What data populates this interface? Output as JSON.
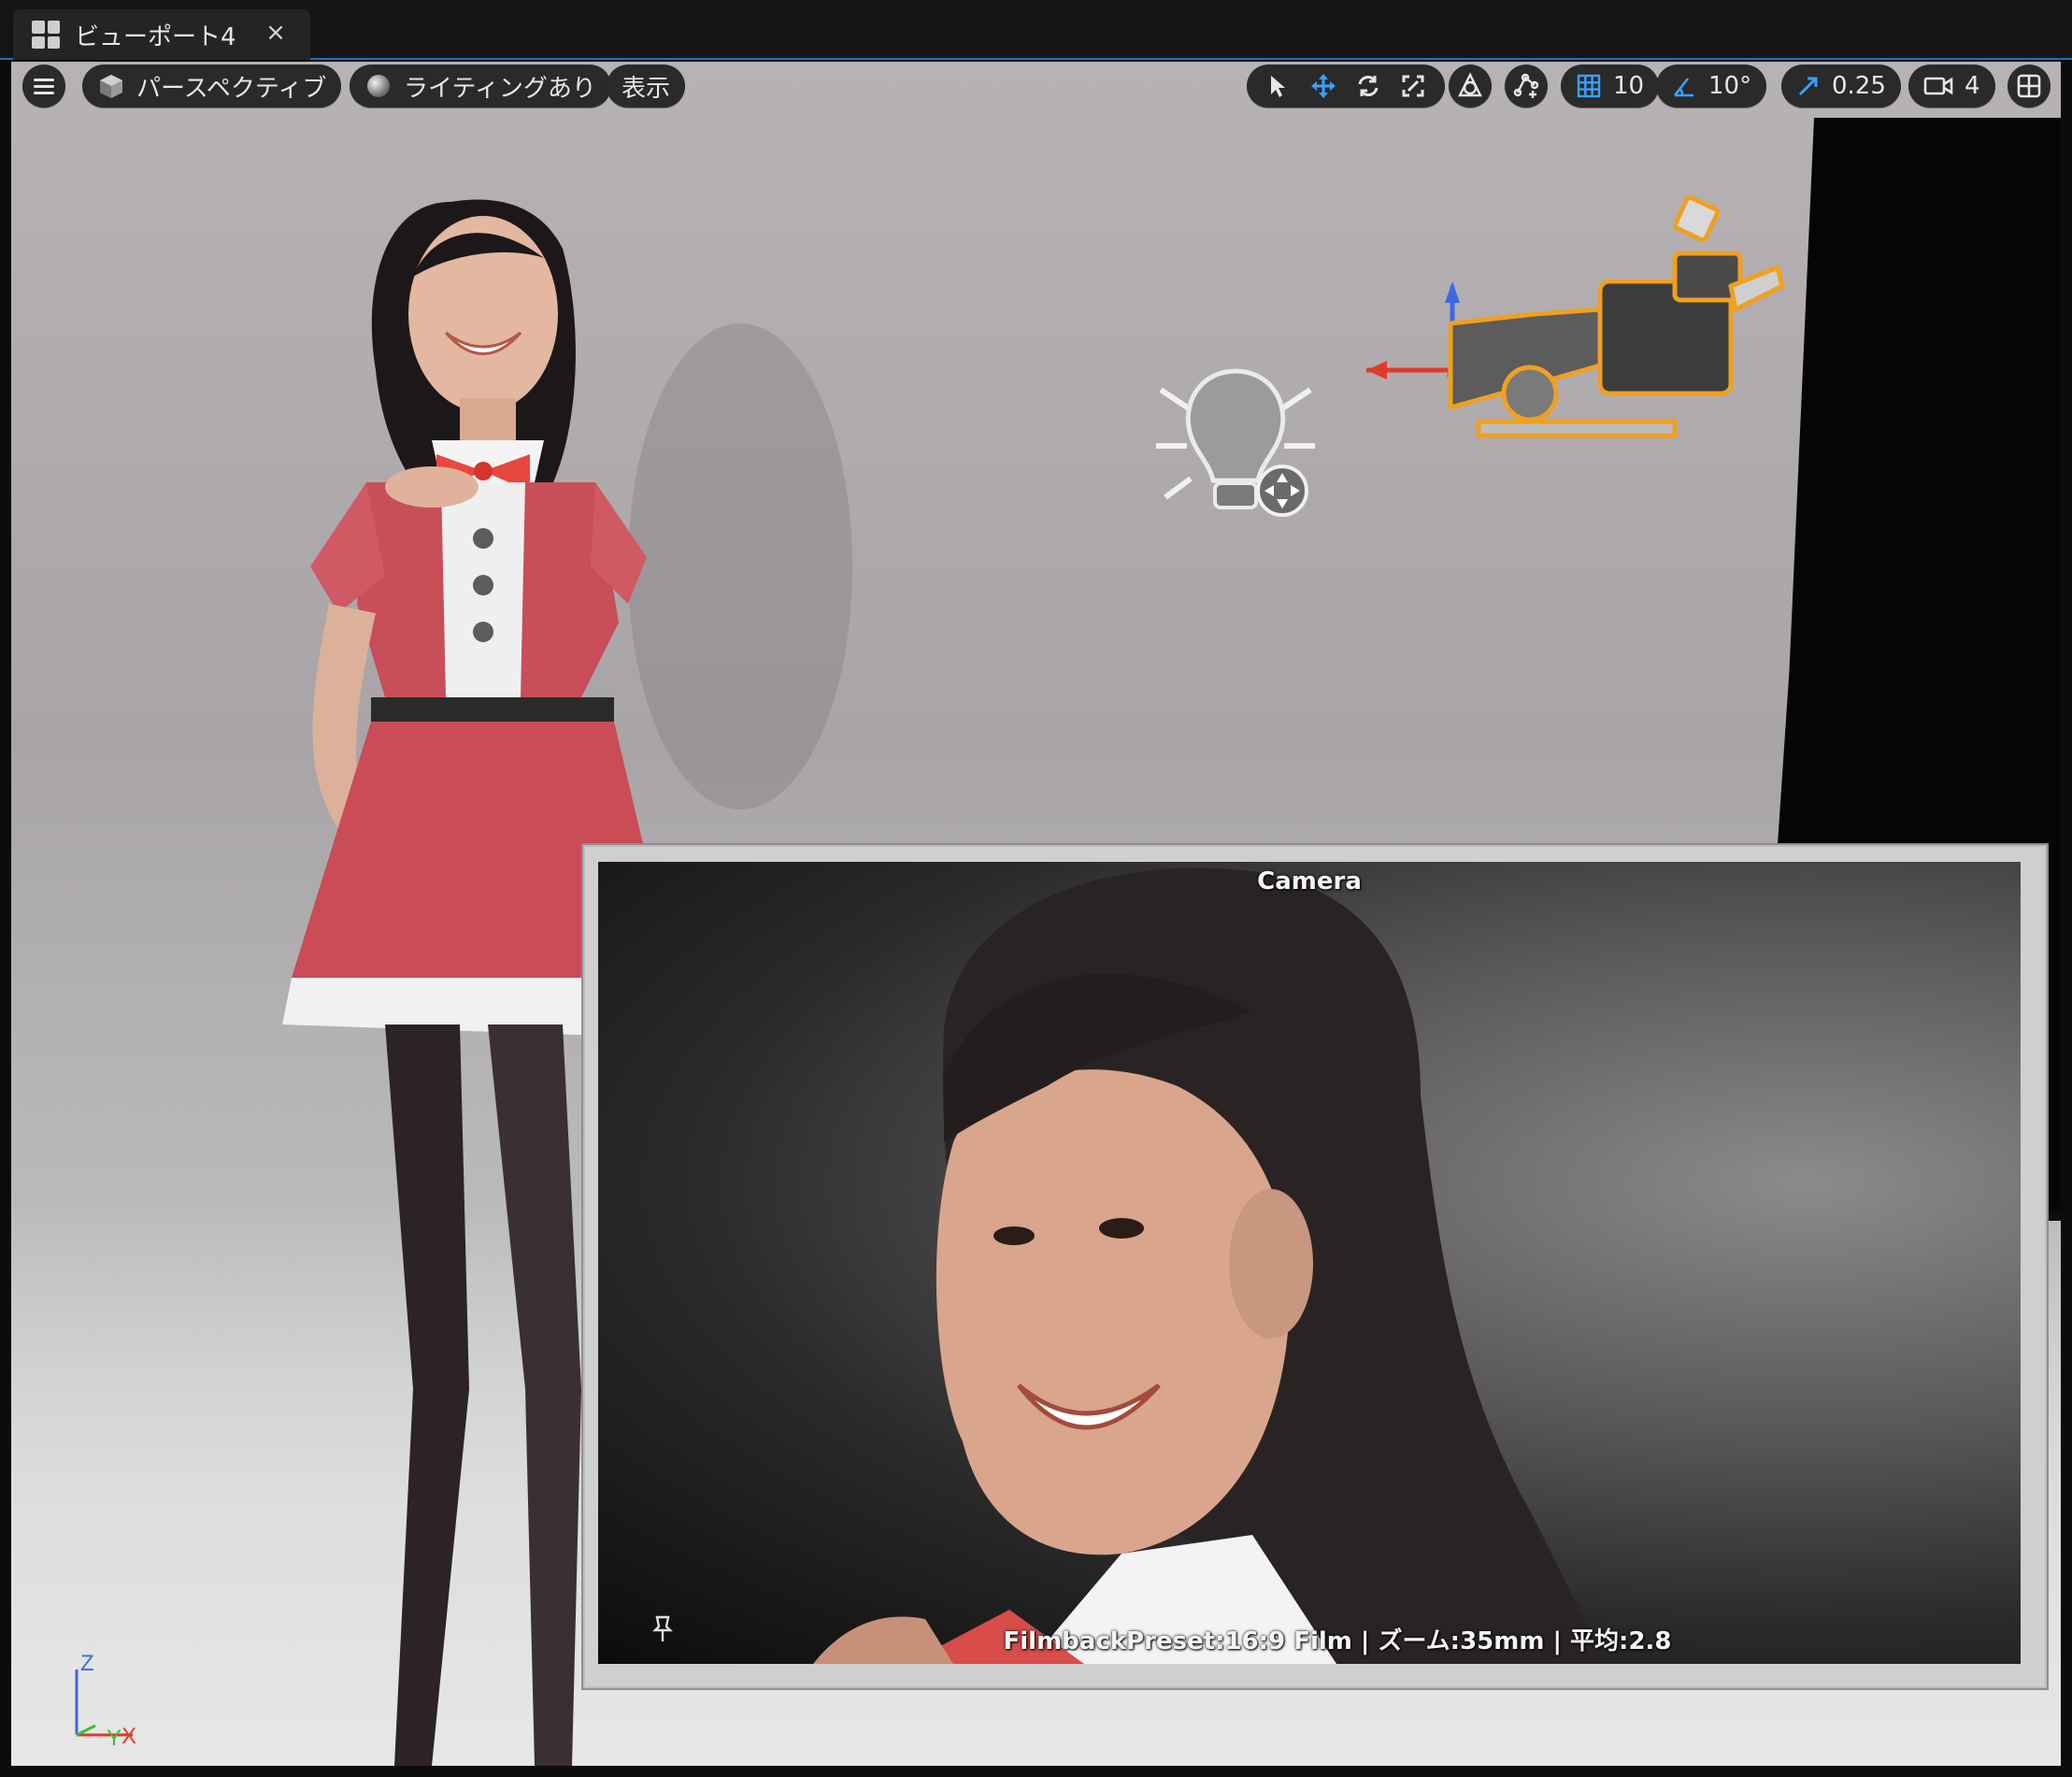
{
  "tab": {
    "title": "ビューポート4",
    "close_glyph": "×",
    "icon": "viewport-layout-icon"
  },
  "toolbar": {
    "perspective_label": "パースペクティブ",
    "lighting_label": "ライティングあり",
    "show_label": "表示",
    "grid_snap_value": "10",
    "rotation_snap_value": "10°",
    "scale_snap_value": "0.25",
    "camera_speed_value": "4",
    "active_tool": "translate",
    "accent_color": "#3aa0ff"
  },
  "preview": {
    "title": "Camera",
    "info": "FilmbackPreset:16:9 Film | ズーム:35mm | 平均:2.8"
  },
  "axis": {
    "z": "Z",
    "y": "Y",
    "x": "X"
  },
  "colors": {
    "selection_outline": "#f0a020",
    "x_axis": "#e03a2a",
    "y_axis": "#3ac03a",
    "z_axis": "#3a6ae0"
  }
}
